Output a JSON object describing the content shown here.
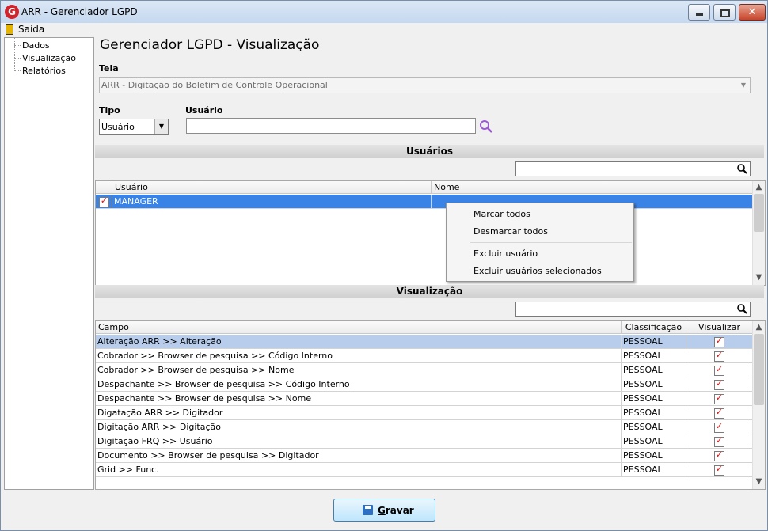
{
  "window": {
    "title": "ARR - Gerenciador LGPD",
    "icon": "arr-logo-icon",
    "controls": [
      "minimize-icon",
      "maximize-icon",
      "close-icon"
    ]
  },
  "menu": {
    "exit_label": "Saída"
  },
  "sidebar": {
    "items": [
      {
        "label": "Dados"
      },
      {
        "label": "Visualização"
      },
      {
        "label": "Relatórios"
      }
    ]
  },
  "page": {
    "title": "Gerenciador LGPD - Visualização"
  },
  "form": {
    "tela_label": "Tela",
    "tela_value": "ARR - Digitação do Boletim de Controle Operacional",
    "tipo_label": "Tipo",
    "tipo_value": "Usuário",
    "usuario_label": "Usuário",
    "usuario_value": ""
  },
  "users_section": {
    "title": "Usuários",
    "search_value": "",
    "columns": [
      "Usuário",
      "Nome"
    ],
    "rows": [
      {
        "usuario": "MANAGER",
        "nome": "",
        "checked": true,
        "selected": true
      }
    ]
  },
  "context_menu": {
    "items": [
      "Marcar todos",
      "Desmarcar todos",
      "Excluir usuário",
      "Excluir usuários selecionados"
    ]
  },
  "view_section": {
    "title": "Visualização",
    "search_value": "",
    "columns": [
      "Campo",
      "Classificação",
      "Visualizar"
    ],
    "rows": [
      {
        "campo": "Alteração ARR >> Alteração",
        "classificacao": "PESSOAL",
        "visualizar": true
      },
      {
        "campo": "Cobrador >> Browser de pesquisa >> Código Interno",
        "classificacao": "PESSOAL",
        "visualizar": true
      },
      {
        "campo": "Cobrador >> Browser de pesquisa >> Nome",
        "classificacao": "PESSOAL",
        "visualizar": true
      },
      {
        "campo": "Despachante >> Browser de pesquisa >> Código Interno",
        "classificacao": "PESSOAL",
        "visualizar": true
      },
      {
        "campo": "Despachante >> Browser de pesquisa >> Nome",
        "classificacao": "PESSOAL",
        "visualizar": true
      },
      {
        "campo": "Digatação ARR >> Digitador",
        "classificacao": "PESSOAL",
        "visualizar": true
      },
      {
        "campo": "Digitação ARR >> Digitação",
        "classificacao": "PESSOAL",
        "visualizar": true
      },
      {
        "campo": "Digitação FRQ >> Usuário",
        "classificacao": "PESSOAL",
        "visualizar": true
      },
      {
        "campo": "Documento >> Browser de pesquisa >> Digitador",
        "classificacao": "PESSOAL",
        "visualizar": true
      },
      {
        "campo": "Grid >> Func.",
        "classificacao": "PESSOAL",
        "visualizar": true
      }
    ]
  },
  "footer": {
    "save_label": "Gravar"
  },
  "colors": {
    "selection": "#3a83e6",
    "check": "#e01010",
    "accent_search": "#9b59d0"
  }
}
